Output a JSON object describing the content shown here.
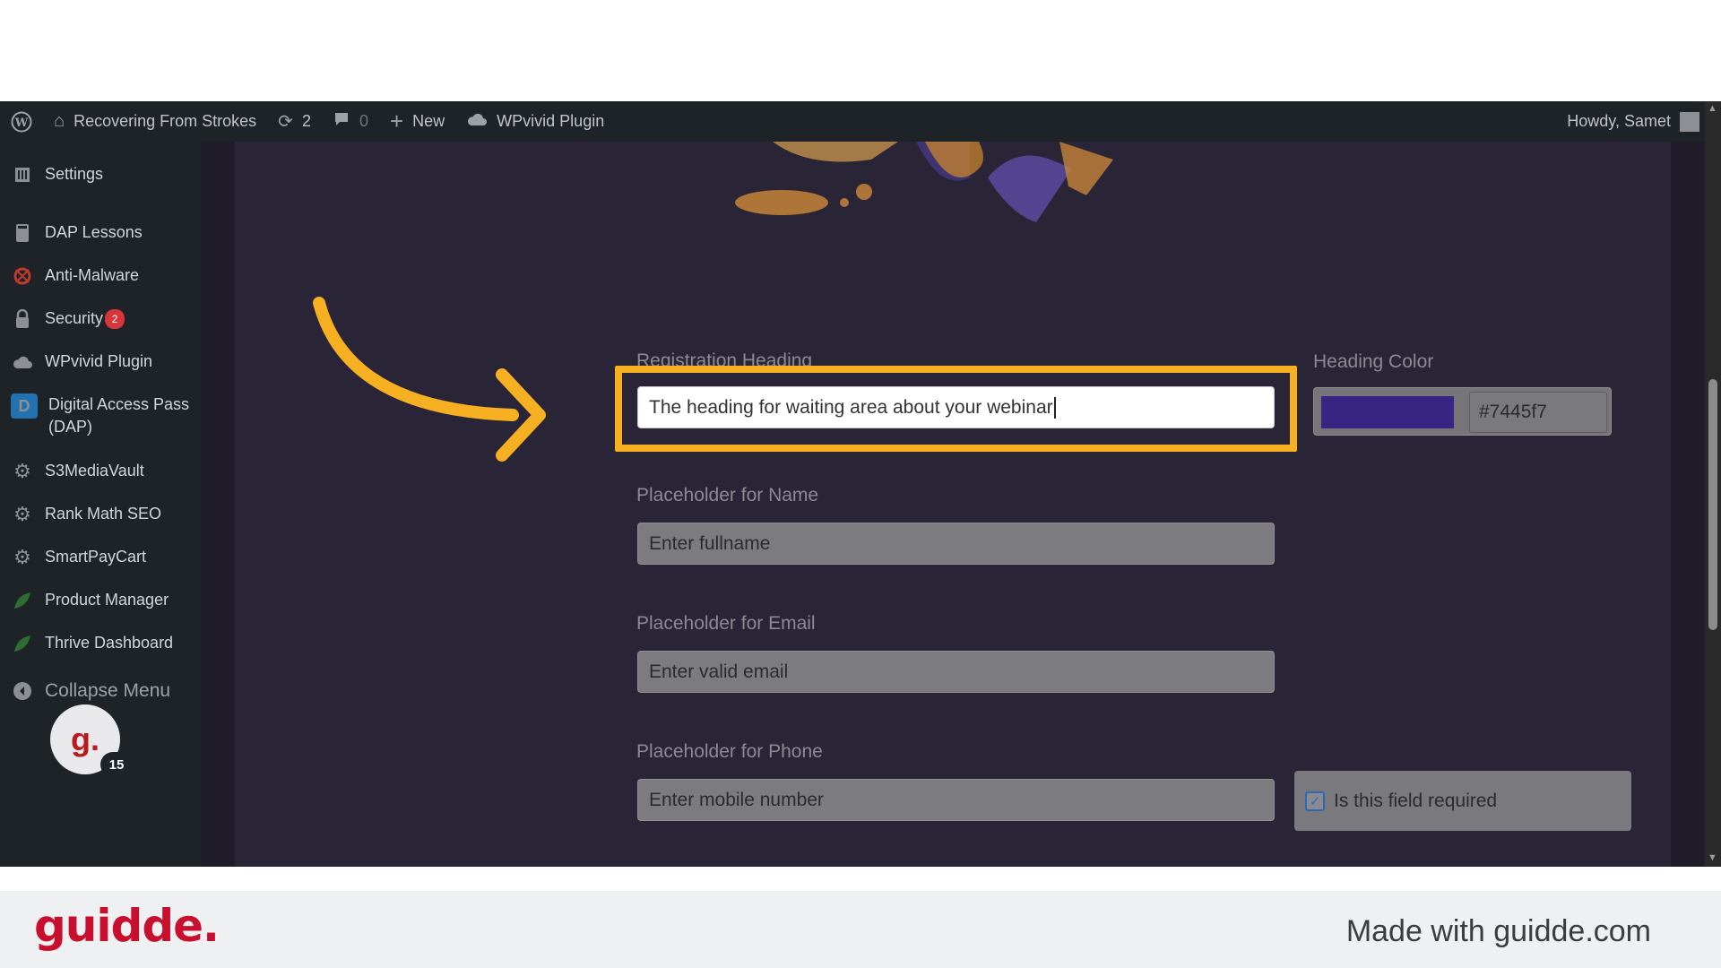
{
  "admin_bar": {
    "site_name": "Recovering From Strokes",
    "updates_count": "2",
    "comments_count": "0",
    "new_label": "New",
    "plugin_label": "WPvivid Plugin",
    "greeting": "Howdy, Samet"
  },
  "sidebar": {
    "items": [
      {
        "label": "Settings",
        "icon": "settings-icon"
      },
      {
        "label": "DAP Lessons",
        "icon": "book-icon"
      },
      {
        "label": "Anti-Malware",
        "icon": "malware-icon"
      },
      {
        "label": "Security",
        "icon": "lock-icon",
        "badge": "2"
      },
      {
        "label": "WPvivid Plugin",
        "icon": "cloud-icon"
      },
      {
        "label": "Digital Access Pass",
        "label2": "(DAP)",
        "icon": "dap-icon"
      },
      {
        "label": "S3MediaVault",
        "icon": "gear-icon"
      },
      {
        "label": "Rank Math SEO",
        "icon": "gear-icon"
      },
      {
        "label": "SmartPayCart",
        "icon": "gear-icon"
      },
      {
        "label": "Product Manager",
        "icon": "leaf-icon"
      },
      {
        "label": "Thrive Dashboard",
        "icon": "leaf-icon"
      }
    ],
    "collapse_label": "Collapse Menu",
    "guidde_avatar_letter": "g.",
    "guidde_count": "15"
  },
  "form": {
    "heading_label": "Registration Heading",
    "heading_value": "The heading for waiting area about your webinar",
    "heading_color_label": "Heading Color",
    "heading_color_value": "#7445f7",
    "swatch_color": "#372483",
    "name_label": "Placeholder for Name",
    "name_value": "Enter fullname",
    "email_label": "Placeholder for Email",
    "email_value": "Enter valid email",
    "phone_label": "Placeholder for Phone",
    "phone_value": "Enter mobile number",
    "required_label": "Is this field required",
    "required_checked": true
  },
  "footer": {
    "brand": "guidde.",
    "made_with": "Made with guidde.com"
  },
  "colors": {
    "highlight": "#f6b021",
    "brand_red": "#c8102e"
  }
}
